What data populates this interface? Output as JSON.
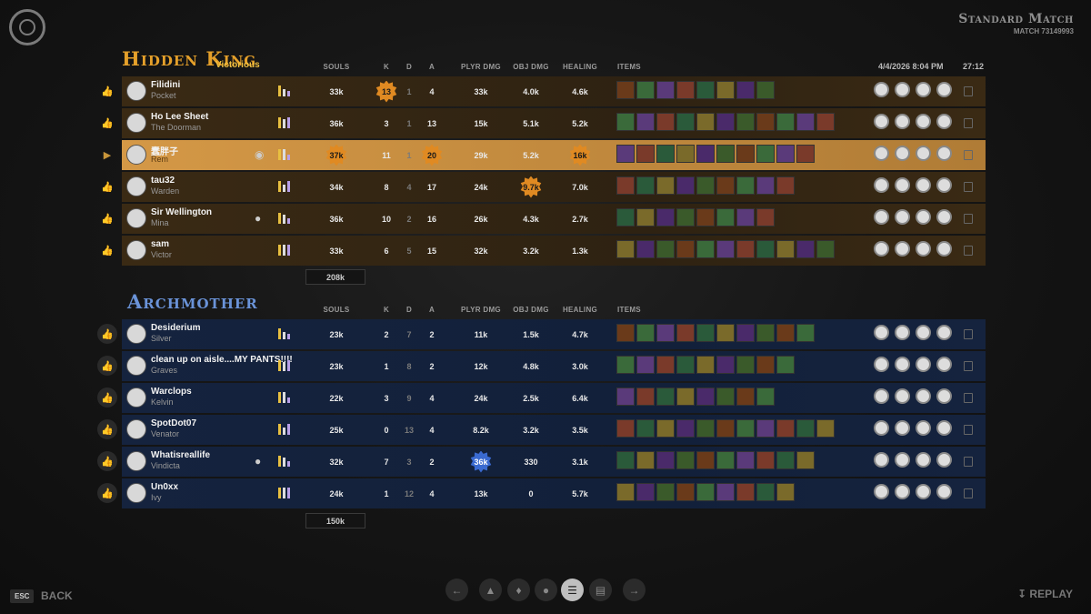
{
  "header": {
    "title": "Standard Match",
    "match_id": "MATCH 73149993",
    "date": "4/4/2026 8:04 PM",
    "duration": "27:12"
  },
  "columns": {
    "souls": "SOULS",
    "k": "K",
    "d": "D",
    "a": "A",
    "player_dmg": "PLYR DMG",
    "obj_dmg": "OBJ DMG",
    "healing": "HEALING",
    "items": "ITEMS"
  },
  "team1": {
    "name": "Hidden King",
    "result": "Victorious",
    "souls_total": "208k",
    "accent": "#e5a02a",
    "players": [
      {
        "name": "Filidini",
        "hero": "Pocket",
        "souls": "33k",
        "k": "13",
        "d": "1",
        "a": "4",
        "player_dmg": "33k",
        "obj_dmg": "4.0k",
        "healing": "4.6k"
      },
      {
        "name": "Ho Lee Sheet",
        "hero": "The Doorman",
        "souls": "36k",
        "k": "3",
        "d": "1",
        "a": "13",
        "player_dmg": "15k",
        "obj_dmg": "5.1k",
        "healing": "5.2k"
      },
      {
        "name": "蠢胖子",
        "hero": "Rem",
        "souls": "37k",
        "k": "11",
        "d": "1",
        "a": "20",
        "player_dmg": "29k",
        "obj_dmg": "5.2k",
        "healing": "16k"
      },
      {
        "name": "tau32",
        "hero": "Warden",
        "souls": "34k",
        "k": "8",
        "d": "4",
        "a": "17",
        "player_dmg": "24k",
        "obj_dmg": "9.7k",
        "healing": "7.0k"
      },
      {
        "name": "Sir Wellington",
        "hero": "Mina",
        "souls": "36k",
        "k": "10",
        "d": "2",
        "a": "16",
        "player_dmg": "26k",
        "obj_dmg": "4.3k",
        "healing": "2.7k"
      },
      {
        "name": "sam",
        "hero": "Victor",
        "souls": "33k",
        "k": "6",
        "d": "5",
        "a": "15",
        "player_dmg": "32k",
        "obj_dmg": "3.2k",
        "healing": "1.3k"
      }
    ]
  },
  "team2": {
    "name": "Archmother",
    "souls_total": "150k",
    "accent": "#6a93d8",
    "players": [
      {
        "name": "Desiderium",
        "hero": "Silver",
        "souls": "23k",
        "k": "2",
        "d": "7",
        "a": "2",
        "player_dmg": "11k",
        "obj_dmg": "1.5k",
        "healing": "4.7k"
      },
      {
        "name": "clean up on aisle....MY PANTS!!!!",
        "hero": "Graves",
        "souls": "23k",
        "k": "1",
        "d": "8",
        "a": "2",
        "player_dmg": "12k",
        "obj_dmg": "4.8k",
        "healing": "3.0k"
      },
      {
        "name": "Warclops",
        "hero": "Kelvin",
        "souls": "22k",
        "k": "3",
        "d": "9",
        "a": "4",
        "player_dmg": "24k",
        "obj_dmg": "2.5k",
        "healing": "6.4k"
      },
      {
        "name": "SpotDot07",
        "hero": "Venator",
        "souls": "25k",
        "k": "0",
        "d": "13",
        "a": "4",
        "player_dmg": "8.2k",
        "obj_dmg": "3.2k",
        "healing": "3.5k"
      },
      {
        "name": "Whatisreallife",
        "hero": "Vindicta",
        "souls": "32k",
        "k": "7",
        "d": "3",
        "a": "2",
        "player_dmg": "36k",
        "obj_dmg": "330",
        "healing": "3.1k"
      },
      {
        "name": "Un0xx",
        "hero": "Ivy",
        "souls": "24k",
        "k": "1",
        "d": "12",
        "a": "4",
        "player_dmg": "13k",
        "obj_dmg": "0",
        "healing": "5.7k"
      }
    ]
  },
  "footer": {
    "esc_key": "ESC",
    "back_label": "BACK",
    "replay_label": "REPLAY"
  }
}
